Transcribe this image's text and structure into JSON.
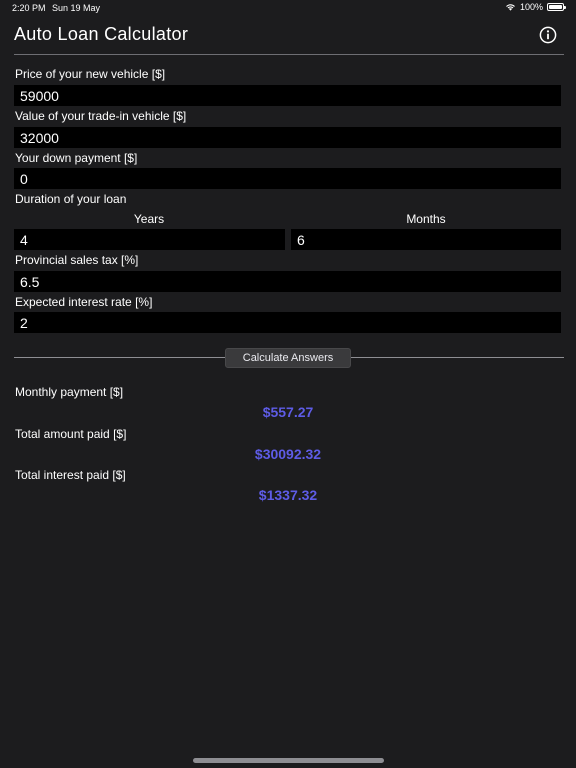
{
  "status_bar": {
    "time": "2:20 PM",
    "date": "Sun 19 May",
    "battery": "100%"
  },
  "nav": {
    "title": "Auto Loan Calculator",
    "info_icon": "info-circle-icon"
  },
  "fields": {
    "price": {
      "label": "Price of your new vehicle [$]",
      "value": "59000"
    },
    "trade_in": {
      "label": "Value of your trade-in vehicle [$]",
      "value": "32000"
    },
    "down_payment": {
      "label": "Your down payment [$]",
      "value": "0"
    },
    "duration": {
      "label": "Duration of your loan",
      "years_label": "Years",
      "months_label": "Months",
      "years_value": "4",
      "months_value": "6"
    },
    "sales_tax": {
      "label": "Provincial sales tax [%]",
      "value": "6.5"
    },
    "interest_rate": {
      "label": "Expected interest rate [%]",
      "value": "2"
    }
  },
  "calculate_label": "Calculate Answers",
  "results": {
    "monthly": {
      "label": "Monthly payment [$]",
      "value": "$557.27"
    },
    "total_paid": {
      "label": "Total amount paid [$]",
      "value": "$30092.32"
    },
    "total_interest": {
      "label": "Total interest paid [$]",
      "value": "$1337.32"
    }
  },
  "colors": {
    "background": "#1c1c1e",
    "input_background": "#000000",
    "accent": "#5e5ce6"
  }
}
